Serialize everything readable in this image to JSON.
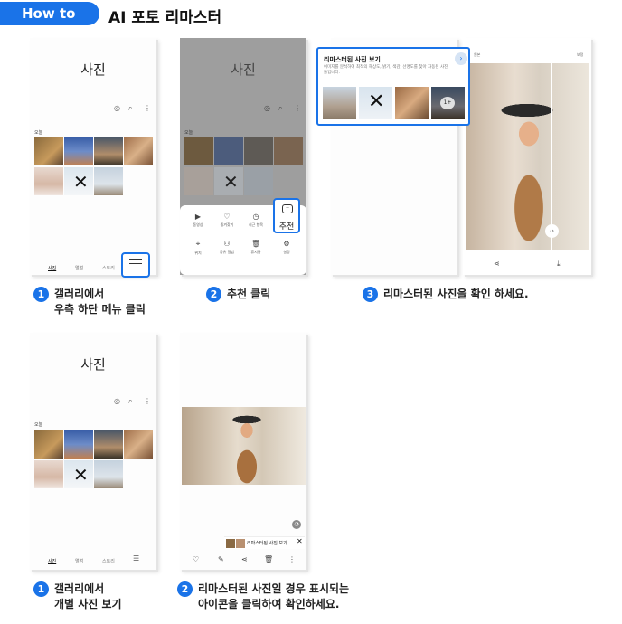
{
  "header": {
    "badge": "How to",
    "title": "AI 포토 리마스터"
  },
  "gallery": {
    "title": "사진",
    "today": "오늘",
    "nav": {
      "photos": "사진",
      "albums": "앨범",
      "stories": "스토리"
    },
    "toolbar_icons": [
      "select-icon",
      "search-icon",
      "more-icon"
    ]
  },
  "sheet": {
    "items_row1": [
      "동영상",
      "즐겨찾기",
      "최근 항목"
    ],
    "recommend": "추천",
    "items_row2": [
      "위치",
      "공유 앨범",
      "휴지통",
      "설정"
    ]
  },
  "popup": {
    "title": "리마스터된 사진 보기",
    "desc": "이미지를 분석하여 최적의 해상도, 밝기, 색감, 선명도를 찾아 자동된 사진들입니다.",
    "more": "1+"
  },
  "compare": {
    "left": "원본",
    "right": "보정"
  },
  "viewer": {
    "remaster_label": "리마스터된 사진 보기"
  },
  "steps_row1": [
    {
      "num": "1",
      "lines": [
        "갤러리에서",
        "우측 하단 메뉴 클릭"
      ]
    },
    {
      "num": "2",
      "lines": [
        "추천 클릭"
      ]
    },
    {
      "num": "3",
      "lines": [
        "리마스터된 사진을 확인 하세요."
      ]
    }
  ],
  "steps_row2": [
    {
      "num": "1",
      "lines": [
        "갤러리에서",
        "개별 사진 보기"
      ]
    },
    {
      "num": "2",
      "lines": [
        "리마스터된 사진일 경우 표시되는",
        "아이콘을 클릭하여 확인하세요."
      ]
    }
  ],
  "colors": {
    "accent": "#1a73e8",
    "dim_overlay": "#9a9a9a"
  }
}
